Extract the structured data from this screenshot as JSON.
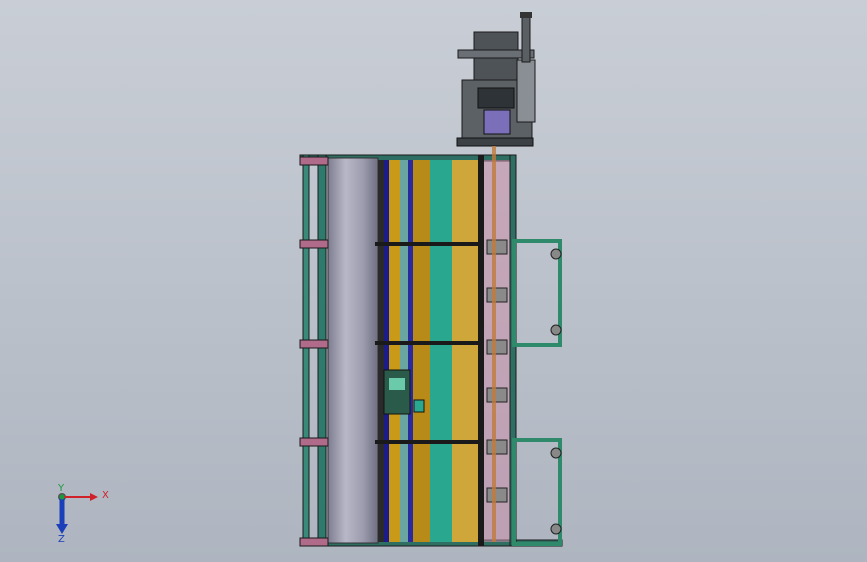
{
  "viewport": {
    "background_top": "#c9ced6",
    "background_bottom": "#aeb5c0"
  },
  "triad": {
    "x_label": "X",
    "y_label": "Y",
    "z_label": "Z",
    "x_color": "#d0202a",
    "y_color": "#1a9a3a",
    "z_color": "#1b3fb8"
  },
  "model": {
    "frame_color": "#1e5a52",
    "bar_colors": [
      "#2a2a2a",
      "#1b1b8c",
      "#c89a18",
      "#6aa5a0",
      "#2aa88f",
      "#cfa63a",
      "#d4b060"
    ],
    "drum_color": "#9a9aa8",
    "accent_pink": "#b05aa8",
    "motor_color": "#555a60"
  }
}
